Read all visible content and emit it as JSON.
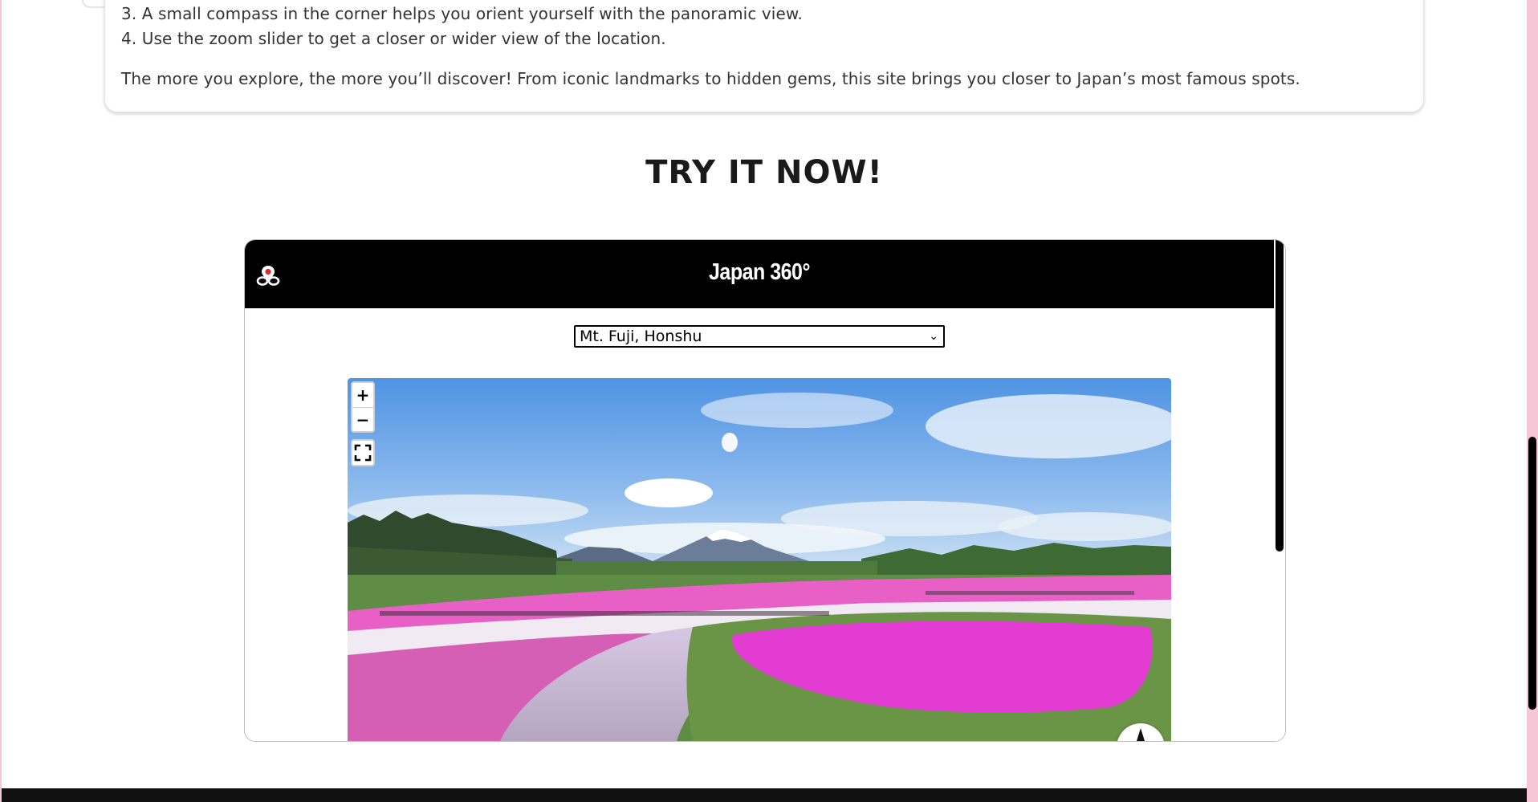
{
  "info": {
    "step3": "3. A small compass in the corner helps you orient yourself with the panoramic view.",
    "step4": "4. Use the zoom slider to get a closer or wider view of the location.",
    "paragraph": "The more you explore, the more you’ll discover! From iconic landmarks to hidden gems, this site brings you closer to Japan’s most famous spots."
  },
  "try_heading": "TRY IT NOW!",
  "viewer": {
    "title": "Japan 360°",
    "logo_icon": "map-pin-logo-icon",
    "location_select": {
      "selected": "Mt. Fuji, Honshu"
    },
    "controls": {
      "zoom_in": "+",
      "zoom_out": "−",
      "fullscreen_icon": "fullscreen-icon",
      "compass_icon": "compass-icon"
    }
  },
  "colors": {
    "page_background": "#f7c6d6",
    "header_background": "#000000",
    "text": "#333333"
  }
}
